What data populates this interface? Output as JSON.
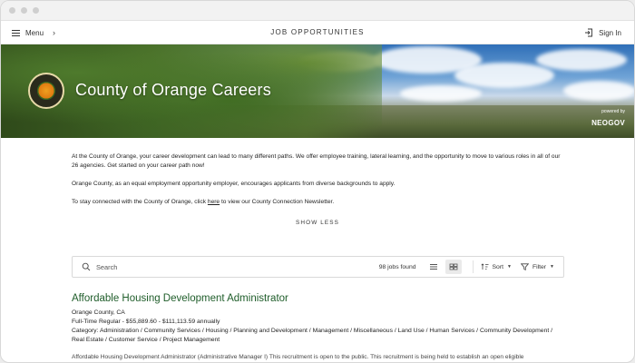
{
  "nav": {
    "menu_label": "Menu",
    "title": "JOB OPPORTUNITIES",
    "signin_label": "Sign In"
  },
  "hero": {
    "title": "County of Orange Careers",
    "powered_by": "powered by",
    "brand": "NEOGOV"
  },
  "intro": {
    "p1": "At the County of Orange, your career development can lead to many different paths.  We offer employee training, lateral learning, and the opportunity to move to various roles in all of our 26 agencies.  Get started on your career path now!",
    "p2": "Orange County, as an equal employment opportunity employer, encourages applicants from diverse backgrounds to apply.",
    "p3_before": "To stay connected with the County of Orange, click ",
    "p3_link": "here",
    "p3_after": " to view our County Connection Newsletter."
  },
  "show_less": "SHOW LESS",
  "search": {
    "placeholder": "Search",
    "jobs_found": "98 jobs found",
    "sort_label": "Sort",
    "filter_label": "Filter"
  },
  "job": {
    "title": "Affordable Housing Development Administrator",
    "location": "Orange County, CA",
    "type_salary": "Full-Time Regular - $55,889.60 - $111,113.59 annually",
    "category": "Category: Administration / Community Services / Housing / Planning and Development / Management / Miscellaneous / Land Use / Human Services / Community Development / Real Estate / Customer Service / Project Management",
    "description": "Affordable Housing Development Administrator (Administrative Manager I) This recruitment is open to the public.  This recruitment is being held to establish an open eligible"
  },
  "colors": {
    "job_title": "#1f5d2a",
    "border": "#d9d9d9"
  },
  "icons": [
    "hamburger-icon",
    "chevron-right-icon",
    "sign-in-icon",
    "county-seal-logo",
    "search-icon",
    "list-view-icon",
    "grid-view-icon",
    "sort-icon",
    "filter-icon"
  ]
}
